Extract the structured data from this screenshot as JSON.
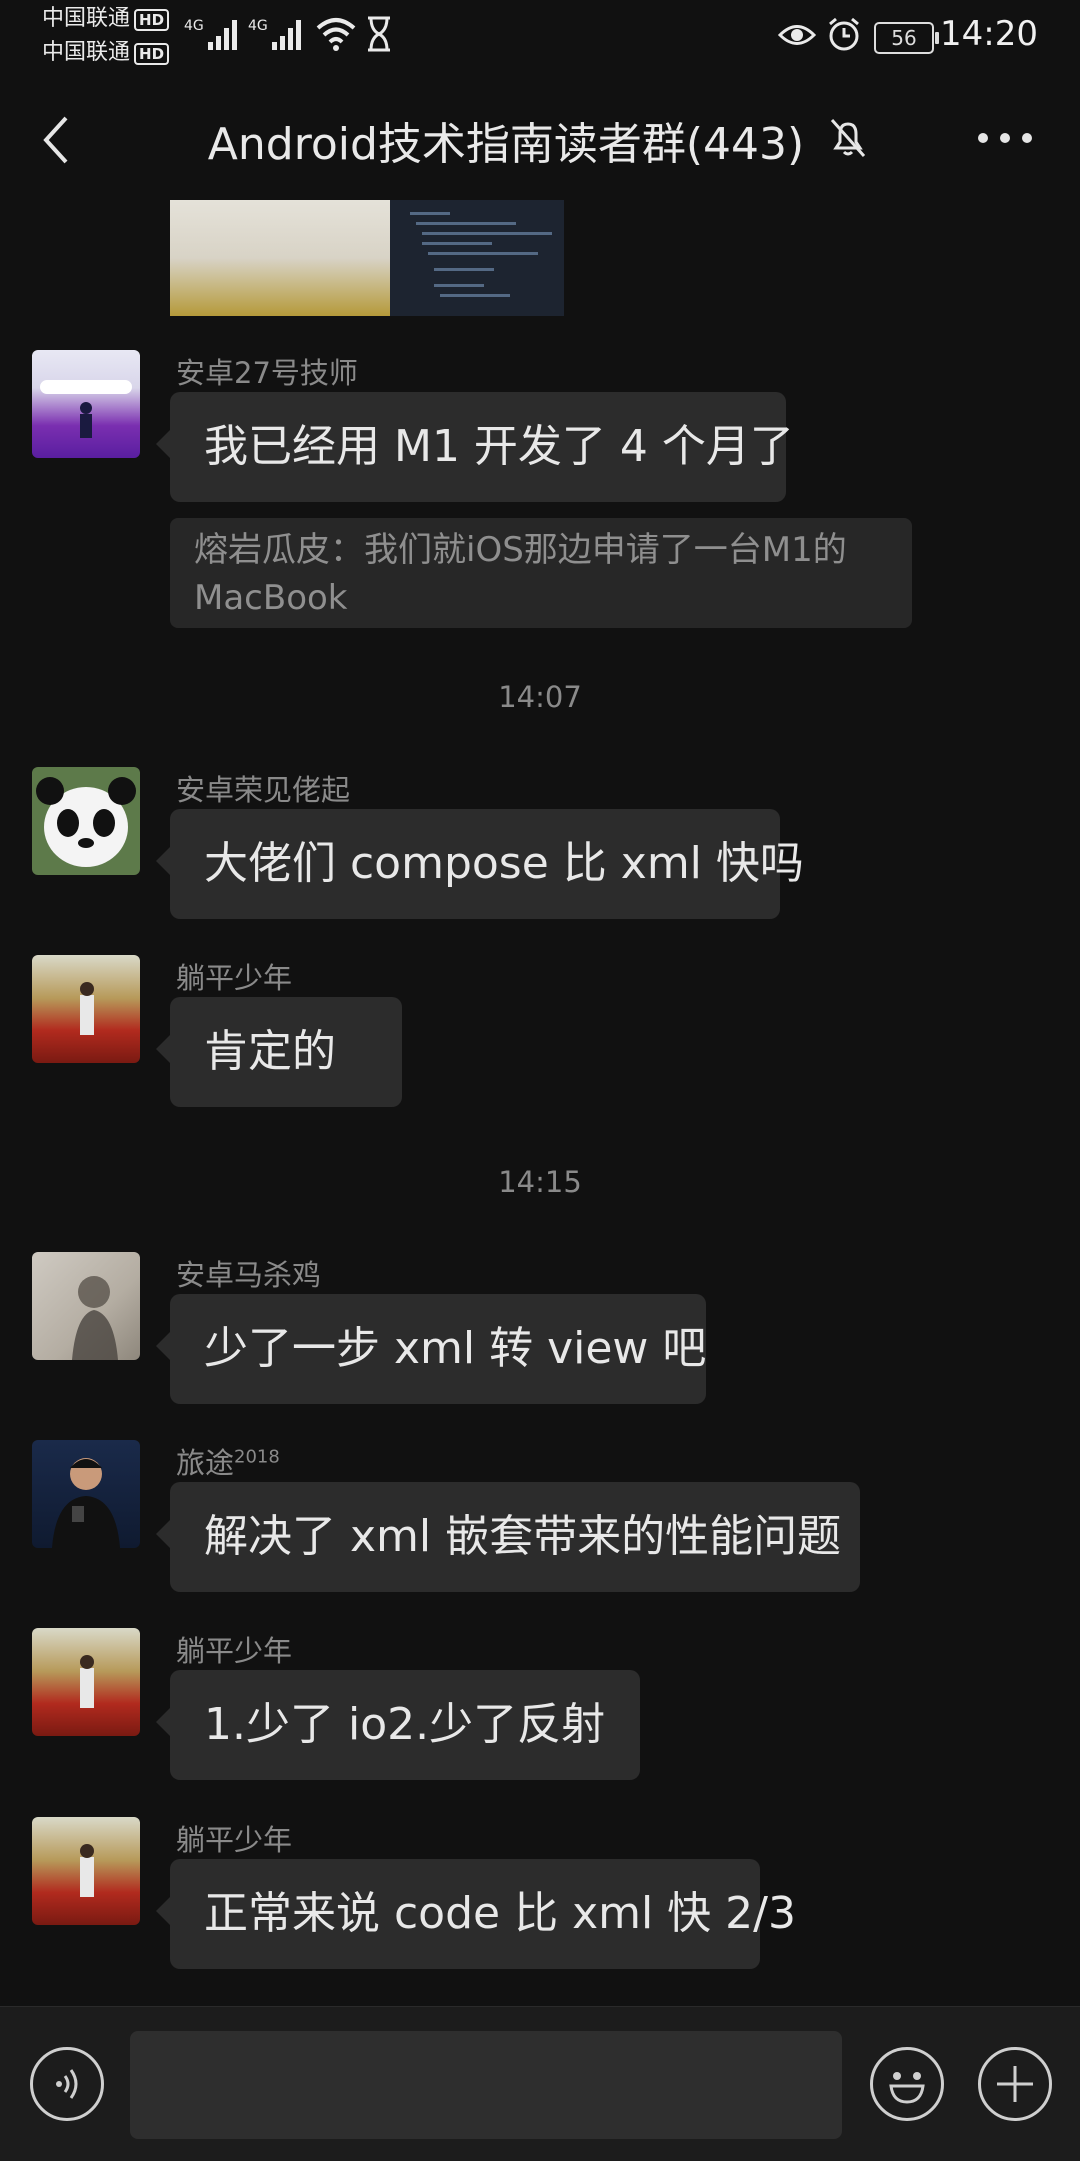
{
  "status_bar": {
    "carrier_1": "中国联通",
    "carrier_2": "中国联通",
    "hd_badge": "HD",
    "network_1": "4G",
    "network_2": "4G",
    "battery": "56",
    "time": "14:20"
  },
  "header": {
    "title": "Android技术指南读者群(443)"
  },
  "messages": [
    {
      "sender": "安卓27号技师",
      "text": "我已经用 M1 开发了 4 个月了",
      "quote": "熔岩瓜皮：我们就iOS那边申请了一台M1的MacBook"
    },
    {
      "timestamp": "14:07"
    },
    {
      "sender": "安卓荣见佬起",
      "text": "大佬们 compose 比 xml 快吗"
    },
    {
      "sender": "躺平少年",
      "text": "肯定的"
    },
    {
      "timestamp": "14:15"
    },
    {
      "sender": "安卓马杀鸡",
      "text": "少了一步 xml 转 view 吧"
    },
    {
      "sender": "旅途",
      "sender_sup": "2018",
      "text": "解决了 xml 嵌套带来的性能问题"
    },
    {
      "sender": "躺平少年",
      "text": "1.少了 io2.少了反射"
    },
    {
      "sender": "躺平少年",
      "text": "正常来说 code 比 xml 快 2/3"
    }
  ],
  "icons": {
    "back": "back-arrow-icon",
    "mute": "bell-off-icon",
    "more": "more-dots-icon",
    "voice": "voice-icon",
    "emoji": "emoji-icon",
    "plus": "plus-icon"
  }
}
